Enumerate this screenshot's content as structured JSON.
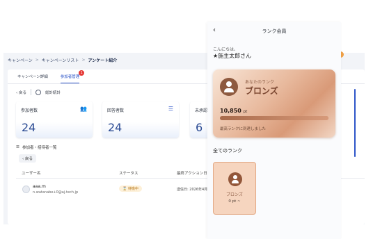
{
  "breadcrumb": {
    "items": [
      "キャンペーン",
      "キャンペーンリスト",
      "アンケート紹介"
    ],
    "separator": ">"
  },
  "tabs": [
    {
      "label": "キャンペーン詳細",
      "active": false
    },
    {
      "label": "参加者管理",
      "active": true,
      "badge": "1"
    }
  ],
  "toolbar": {
    "back_label": "戻る",
    "stats_label": "総計統計"
  },
  "stats": [
    {
      "label": "参加者数",
      "value": "24",
      "icon": "users-icon"
    },
    {
      "label": "回答者数",
      "value": "24",
      "icon": "list-icon"
    },
    {
      "label": "未承認",
      "value": "6"
    }
  ],
  "list": {
    "title": "参加者・招待者一覧",
    "back_label": "戻る",
    "columns": [
      "ユーザー名",
      "ステータス",
      "最終アクション日時"
    ],
    "rows": [
      {
        "name": "aaa.m",
        "email": "n.watanabe+0@aj-tech.jp",
        "status": "待機中",
        "sent_at": "送信日: 2026年4月2"
      }
    ]
  },
  "modal": {
    "title": "ランク会員",
    "greeting": "こんにちは、",
    "user_name": "★施主太郎さん",
    "card": {
      "caption": "あなたのランク",
      "rank": "ブロンズ",
      "points_value": "10,850",
      "points_unit": "pt",
      "progress": 1.0,
      "note": "最高ランクに到達しました"
    },
    "all_ranks_title": "全てのランク",
    "ranks": [
      {
        "name": "ブロンズ",
        "points": "0 pt ~"
      }
    ]
  },
  "colors": {
    "accent": "#2d55c8",
    "bronze": "#e8b99d",
    "status_bg": "#fdf0d8"
  }
}
